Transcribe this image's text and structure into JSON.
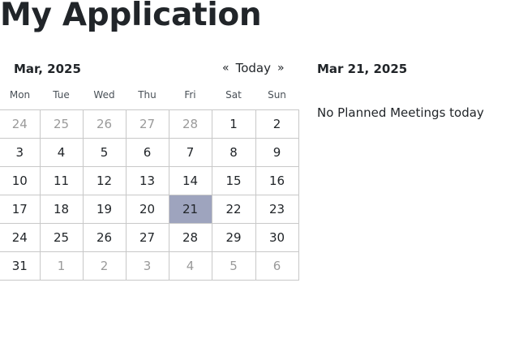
{
  "app": {
    "title": "My Application"
  },
  "calendar": {
    "month_label": "Mar, 2025",
    "nav": {
      "prev": "«",
      "today": "Today",
      "next": "»"
    },
    "weekdays": [
      "Mon",
      "Tue",
      "Wed",
      "Thu",
      "Fri",
      "Sat",
      "Sun"
    ],
    "weeks": [
      [
        {
          "d": "24",
          "m": true
        },
        {
          "d": "25",
          "m": true
        },
        {
          "d": "26",
          "m": true
        },
        {
          "d": "27",
          "m": true
        },
        {
          "d": "28",
          "m": true
        },
        {
          "d": "1"
        },
        {
          "d": "2"
        }
      ],
      [
        {
          "d": "3"
        },
        {
          "d": "4"
        },
        {
          "d": "5"
        },
        {
          "d": "6"
        },
        {
          "d": "7"
        },
        {
          "d": "8"
        },
        {
          "d": "9"
        }
      ],
      [
        {
          "d": "10"
        },
        {
          "d": "11"
        },
        {
          "d": "12"
        },
        {
          "d": "13"
        },
        {
          "d": "14"
        },
        {
          "d": "15"
        },
        {
          "d": "16"
        }
      ],
      [
        {
          "d": "17"
        },
        {
          "d": "18"
        },
        {
          "d": "19"
        },
        {
          "d": "20"
        },
        {
          "d": "21",
          "sel": true
        },
        {
          "d": "22"
        },
        {
          "d": "23"
        }
      ],
      [
        {
          "d": "24"
        },
        {
          "d": "25"
        },
        {
          "d": "26"
        },
        {
          "d": "27"
        },
        {
          "d": "28"
        },
        {
          "d": "29"
        },
        {
          "d": "30"
        }
      ],
      [
        {
          "d": "31"
        },
        {
          "d": "1",
          "m": true
        },
        {
          "d": "2",
          "m": true
        },
        {
          "d": "3",
          "m": true
        },
        {
          "d": "4",
          "m": true
        },
        {
          "d": "5",
          "m": true
        },
        {
          "d": "6",
          "m": true
        }
      ]
    ],
    "selected_color": "#9ea4be",
    "muted_color": "#9a9a9a"
  },
  "details": {
    "date": "Mar 21, 2025",
    "empty_message": "No Planned Meetings today"
  }
}
